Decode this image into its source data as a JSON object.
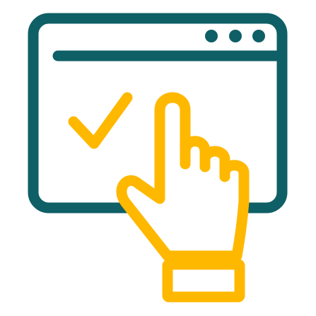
{
  "icon": {
    "name": "browser-click-confirm-icon",
    "colors": {
      "window": "#0f5f66",
      "accent": "#ffb800",
      "background": "#ffffff"
    },
    "window_control_dots": 3
  }
}
